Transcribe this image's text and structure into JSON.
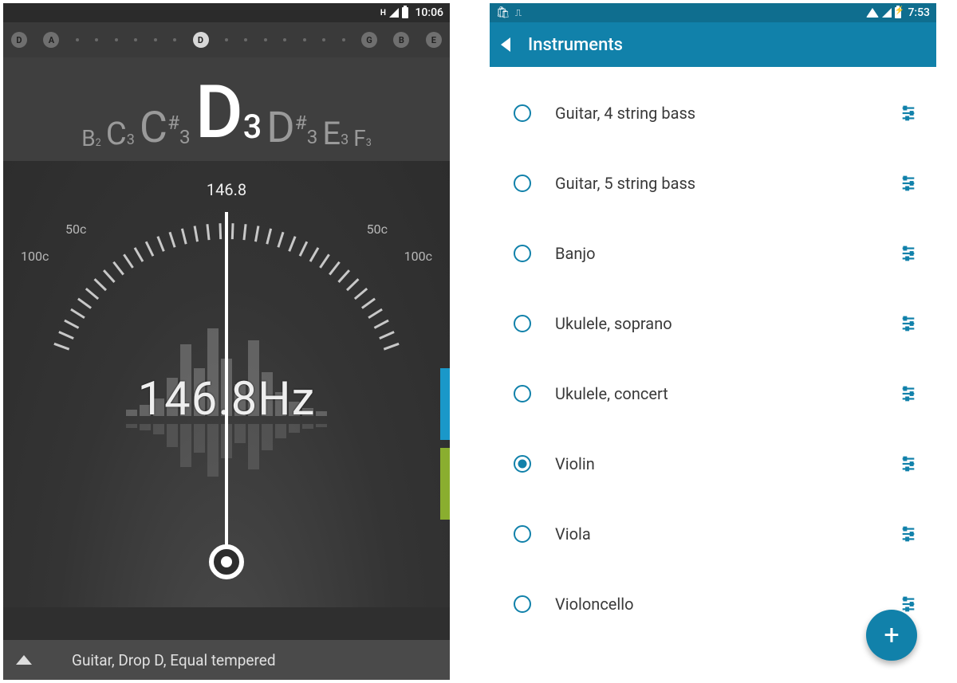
{
  "left": {
    "status": {
      "net": "H",
      "time": "10:06"
    },
    "strings": [
      "D",
      "A",
      "",
      "",
      "",
      "",
      "",
      "",
      "D",
      "",
      "",
      "",
      "",
      "",
      "",
      "",
      "G",
      "B",
      "E"
    ],
    "string_active_index": 8,
    "notes": [
      {
        "name": "B",
        "oct": "2",
        "sharp": ""
      },
      {
        "name": "C",
        "oct": "3",
        "sharp": ""
      },
      {
        "name": "C",
        "oct": "3",
        "sharp": "#"
      },
      {
        "name": "D",
        "oct": "3",
        "sharp": ""
      },
      {
        "name": "D",
        "oct": "3",
        "sharp": "#"
      },
      {
        "name": "E",
        "oct": "3",
        "sharp": ""
      },
      {
        "name": "F",
        "oct": "3",
        "sharp": ""
      }
    ],
    "center_note_index": 3,
    "freq_top": "146.8",
    "freq_main": "146.8Hz",
    "cents": {
      "l100": "100c",
      "l50": "50c",
      "r50": "50c",
      "r100": "100c"
    },
    "bottom_label": "Guitar, Drop D, Equal tempered"
  },
  "right": {
    "status": {
      "time": "7:53"
    },
    "title": "Instruments",
    "instruments": [
      {
        "label": "Guitar, 4 string bass",
        "selected": false
      },
      {
        "label": "Guitar, 5 string bass",
        "selected": false
      },
      {
        "label": "Banjo",
        "selected": false
      },
      {
        "label": "Ukulele, soprano",
        "selected": false
      },
      {
        "label": "Ukulele, concert",
        "selected": false
      },
      {
        "label": "Violin",
        "selected": true
      },
      {
        "label": "Viola",
        "selected": false
      },
      {
        "label": "Violoncello",
        "selected": false
      }
    ]
  },
  "colors": {
    "accent_dark": "#1181aa",
    "accent_blue_tab": "#1a98c9",
    "accent_green_tab": "#8aae2f"
  }
}
